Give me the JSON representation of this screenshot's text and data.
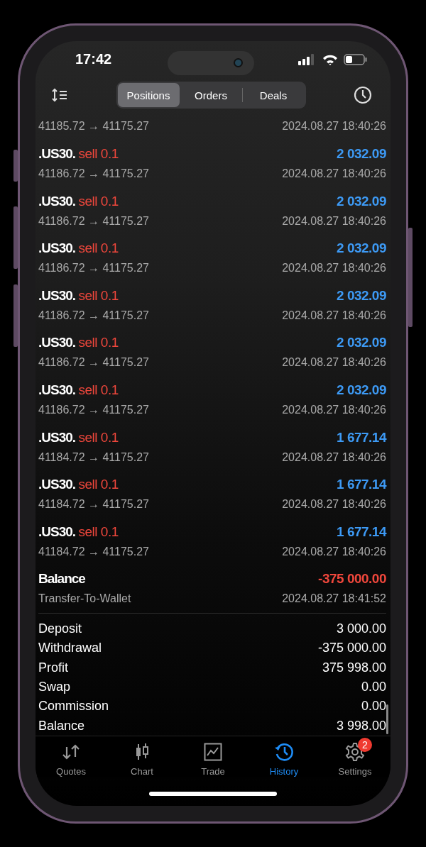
{
  "status_bar": {
    "time": "17:42"
  },
  "tabs": [
    {
      "label": "Positions",
      "selected": true
    },
    {
      "label": "Orders",
      "selected": false
    },
    {
      "label": "Deals",
      "selected": false
    }
  ],
  "partial_row": {
    "prices": "41185.72 → 41175.27",
    "time": "2024.08.27 18:40:26"
  },
  "deals": [
    {
      "kind": "trade",
      "symbol": ".US30.",
      "type": "sell 0.1",
      "amount": "2 032.09",
      "color": "#3d9af5",
      "prices": "41186.72 → 41175.27",
      "time": "2024.08.27 18:40:26"
    },
    {
      "kind": "trade",
      "symbol": ".US30.",
      "type": "sell 0.1",
      "amount": "2 032.09",
      "color": "#3d9af5",
      "prices": "41186.72 → 41175.27",
      "time": "2024.08.27 18:40:26"
    },
    {
      "kind": "trade",
      "symbol": ".US30.",
      "type": "sell 0.1",
      "amount": "2 032.09",
      "color": "#3d9af5",
      "prices": "41186.72 → 41175.27",
      "time": "2024.08.27 18:40:26"
    },
    {
      "kind": "trade",
      "symbol": ".US30.",
      "type": "sell 0.1",
      "amount": "2 032.09",
      "color": "#3d9af5",
      "prices": "41186.72 → 41175.27",
      "time": "2024.08.27 18:40:26"
    },
    {
      "kind": "trade",
      "symbol": ".US30.",
      "type": "sell 0.1",
      "amount": "2 032.09",
      "color": "#3d9af5",
      "prices": "41186.72 → 41175.27",
      "time": "2024.08.27 18:40:26"
    },
    {
      "kind": "trade",
      "symbol": ".US30.",
      "type": "sell 0.1",
      "amount": "2 032.09",
      "color": "#3d9af5",
      "prices": "41186.72 → 41175.27",
      "time": "2024.08.27 18:40:26"
    },
    {
      "kind": "trade",
      "symbol": ".US30.",
      "type": "sell 0.1",
      "amount": "1 677.14",
      "color": "#3d9af5",
      "prices": "41184.72 → 41175.27",
      "time": "2024.08.27 18:40:26"
    },
    {
      "kind": "trade",
      "symbol": ".US30.",
      "type": "sell 0.1",
      "amount": "1 677.14",
      "color": "#3d9af5",
      "prices": "41184.72 → 41175.27",
      "time": "2024.08.27 18:40:26"
    },
    {
      "kind": "trade",
      "symbol": ".US30.",
      "type": "sell 0.1",
      "amount": "1 677.14",
      "color": "#3d9af5",
      "prices": "41184.72 → 41175.27",
      "time": "2024.08.27 18:40:26"
    },
    {
      "kind": "balance",
      "symbol": "Balance",
      "amount": "-375 000.00",
      "color": "#f0473c",
      "prices": "Transfer-To-Wallet",
      "time": "2024.08.27 18:41:52"
    }
  ],
  "summary": [
    {
      "label": "Deposit",
      "value": "3 000.00"
    },
    {
      "label": "Withdrawal",
      "value": "-375 000.00"
    },
    {
      "label": "Profit",
      "value": "375 998.00"
    },
    {
      "label": "Swap",
      "value": "0.00"
    },
    {
      "label": "Commission",
      "value": "0.00"
    },
    {
      "label": "Balance",
      "value": "3 998.00"
    }
  ],
  "nav": [
    {
      "kind": "quotes",
      "label": "Quotes",
      "selected": false
    },
    {
      "kind": "chart",
      "label": "Chart",
      "selected": false
    },
    {
      "kind": "trade",
      "label": "Trade",
      "selected": false
    },
    {
      "kind": "history",
      "label": "History",
      "selected": true
    },
    {
      "kind": "settings",
      "label": "Settings",
      "selected": false,
      "badge": "2"
    }
  ]
}
